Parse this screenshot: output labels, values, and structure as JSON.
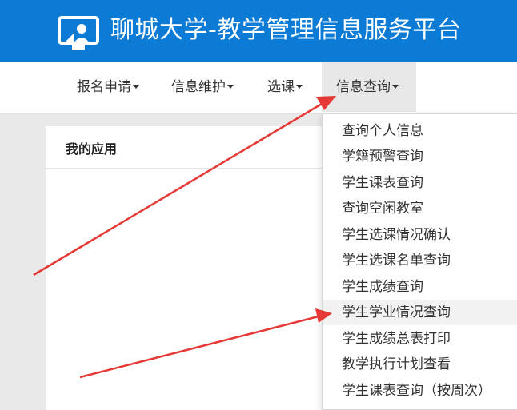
{
  "header": {
    "title": "聊城大学-教学管理信息服务平台"
  },
  "nav": {
    "items": [
      {
        "label": "报名申请"
      },
      {
        "label": "信息维护"
      },
      {
        "label": "选课"
      },
      {
        "label": "信息查询"
      }
    ]
  },
  "panel": {
    "title": "我的应用"
  },
  "dropdown": {
    "items": [
      {
        "label": "查询个人信息"
      },
      {
        "label": "学籍预警查询"
      },
      {
        "label": "学生课表查询"
      },
      {
        "label": "查询空闲教室"
      },
      {
        "label": "学生选课情况确认"
      },
      {
        "label": "学生选课名单查询"
      },
      {
        "label": "学生成绩查询"
      },
      {
        "label": "学生学业情况查询"
      },
      {
        "label": "学生成绩总表打印"
      },
      {
        "label": "教学执行计划查看"
      },
      {
        "label": "学生课表查询（按周次）"
      }
    ]
  },
  "colors": {
    "header_bg": "#0b7bd6",
    "arrow": "#e53935",
    "hover_bg": "#f2f2f2"
  }
}
